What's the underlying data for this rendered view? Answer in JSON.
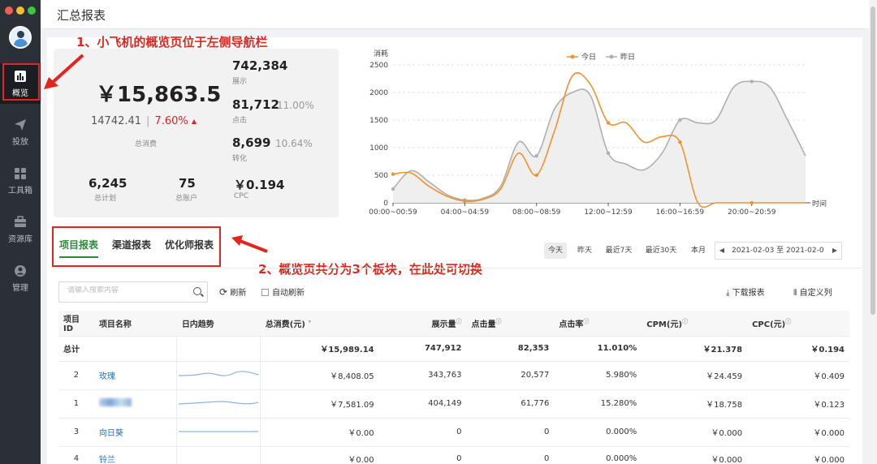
{
  "window": {
    "traffic_colors": [
      "#ee5f58",
      "#f5bd2f",
      "#3bc840"
    ]
  },
  "sidebar": {
    "items": [
      {
        "label": "概览",
        "icon": "bar-chart-icon",
        "active": true
      },
      {
        "label": "投放",
        "icon": "paper-plane-icon",
        "active": false
      },
      {
        "label": "工具箱",
        "icon": "grid-icon",
        "active": false
      },
      {
        "label": "资源库",
        "icon": "toolbox-icon",
        "active": false
      },
      {
        "label": "管理",
        "icon": "user-circle-icon",
        "active": false
      }
    ]
  },
  "header": {
    "title": "汇总报表"
  },
  "annotations": {
    "a1": "1、小飞机的概览页位于左侧导航栏",
    "a2": "2、概览页共分为3个板块，在此处可切换"
  },
  "summary": {
    "total_spend": "￥15,863.5",
    "prev_spend": "14742.41",
    "change_pct": "7.60%",
    "total_spend_label": "总消费",
    "impressions": "742,384",
    "impressions_label": "展示",
    "clicks": "81,712",
    "click_rate": "11.00%",
    "clicks_label": "点击",
    "conversions": "8,699",
    "conversion_rate": "10.64%",
    "conversions_label": "转化",
    "plans": "6,245",
    "plans_label": "总计划",
    "accounts": "75",
    "accounts_label": "总账户",
    "cpc": "￥0.194",
    "cpc_label": "CPC"
  },
  "chart_data": {
    "type": "line",
    "ylabel": "消耗",
    "xlabel": "时间",
    "ylim": [
      0,
      2500
    ],
    "yticks": [
      0,
      500,
      1000,
      1500,
      2000,
      2500
    ],
    "categories": [
      "00:00~00:59",
      "01:00~01:59",
      "02:00~02:59",
      "03:00~03:59",
      "04:00~04:59",
      "05:00~05:59",
      "06:00~06:59",
      "07:00~07:59",
      "08:00~08:59",
      "09:00~09:59",
      "10:00~10:59",
      "11:00~11:59",
      "12:00~12:59",
      "13:00~13:59",
      "14:00~14:59",
      "15:00~15:59",
      "16:00~16:59",
      "17:00~17:59",
      "18:00~18:59",
      "19:00~19:59",
      "20:00~20:59",
      "21:00~21:59",
      "22:00~22:59",
      "23:00~23:59"
    ],
    "xtick_labels": [
      "00:00~00:59",
      "04:00~04:59",
      "08:00~08:59",
      "12:00~12:59",
      "16:00~16:59",
      "20:00~20:59"
    ],
    "legend_position": "top-center",
    "series": [
      {
        "name": "今日",
        "color": "#f5912a",
        "values": [
          520,
          540,
          300,
          120,
          30,
          60,
          250,
          900,
          500,
          1300,
          2300,
          2150,
          1450,
          1450,
          1100,
          1200,
          1100,
          0,
          0,
          0,
          0,
          0,
          0,
          0
        ]
      },
      {
        "name": "昨日",
        "color": "#b0b0b0",
        "values": [
          250,
          580,
          380,
          150,
          50,
          80,
          300,
          1100,
          850,
          1700,
          2000,
          1950,
          900,
          700,
          600,
          900,
          1500,
          1450,
          1500,
          2100,
          2200,
          2100,
          1500,
          850
        ]
      }
    ]
  },
  "tabs": [
    "项目报表",
    "渠道报表",
    "优化师报表"
  ],
  "date_filters": [
    "今天",
    "昨天",
    "最近7天",
    "最近30天",
    "本月"
  ],
  "date_range": "2021-02-03 至 2021-02-0",
  "toolbar": {
    "search_placeholder": "请输入搜索内容",
    "refresh": "刷新",
    "auto_refresh": "自动刷新",
    "download": "下载报表",
    "custom_columns": "自定义列"
  },
  "table": {
    "headers": [
      "项目ID",
      "项目名称",
      "日内趋势",
      "总消费(元)",
      "展示量",
      "点击量",
      "点击率",
      "CPM(元)",
      "CPC(元)"
    ],
    "total": {
      "label": "总计",
      "spend": "￥15,989.14",
      "impressions": "747,912",
      "clicks": "82,353",
      "ctr": "11.010%",
      "cpm": "￥21.378",
      "cpc": "￥0.194"
    },
    "rows": [
      {
        "id": "2",
        "name": "玫瑰",
        "spend": "￥8,408.05",
        "impressions": "343,763",
        "clicks": "20,577",
        "ctr": "5.980%",
        "cpm": "￥24.459",
        "cpc": "￥0.409"
      },
      {
        "id": "1",
        "name": "",
        "spend": "￥7,581.09",
        "impressions": "404,149",
        "clicks": "61,776",
        "ctr": "15.280%",
        "cpm": "￥18.758",
        "cpc": "￥0.123"
      },
      {
        "id": "3",
        "name": "向日葵",
        "spend": "￥0.00",
        "impressions": "0",
        "clicks": "0",
        "ctr": "0.000%",
        "cpm": "￥0.000",
        "cpc": "￥0.000"
      },
      {
        "id": "4",
        "name": "铃兰",
        "spend": "￥0.00",
        "impressions": "0",
        "clicks": "0",
        "ctr": "0.000%",
        "cpm": "￥0.000",
        "cpc": "￥0.000"
      }
    ]
  }
}
